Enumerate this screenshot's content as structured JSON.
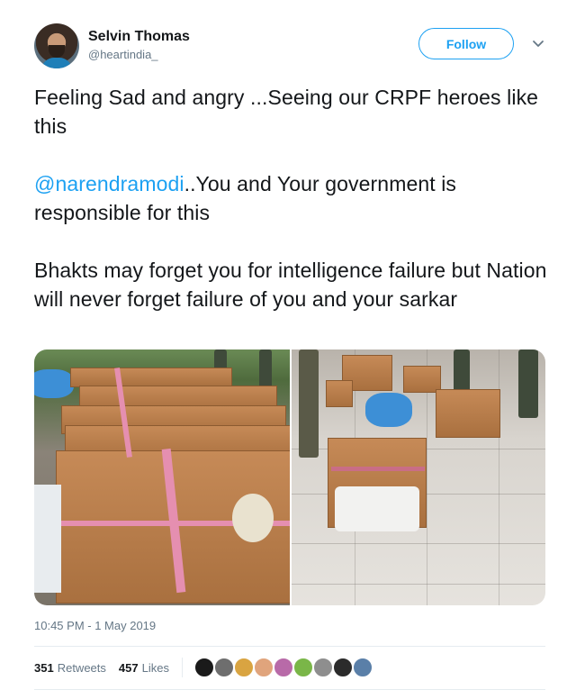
{
  "author": {
    "name": "Selvin Thomas",
    "handle": "@heartindia_",
    "avatar_icon": "user-avatar-photo"
  },
  "follow": {
    "label": "Follow",
    "color": "#1da1f2"
  },
  "menu": {
    "icon": "chevron-down-icon"
  },
  "tweet": {
    "line1": "Feeling Sad and angry ...Seeing our CRPF heroes like this",
    "mention": "@narendramodi",
    "line2_rest": "..You and Your government is responsible for this",
    "line3": "Bhakts may forget you for intelligence failure but Nation will never forget failure of you and your sarkar"
  },
  "media": {
    "photos": [
      {
        "name": "left-photo",
        "icon": "cardboard-coffins-outdoors"
      },
      {
        "name": "right-photo",
        "icon": "cardboard-coffins-on-tiled-floor"
      }
    ]
  },
  "meta": {
    "timestamp": "10:45 PM - 1 May 2019"
  },
  "stats": {
    "retweets_count": "351",
    "retweets_label": "Retweets",
    "likes_count": "457",
    "likes_label": "Likes"
  },
  "likers": [
    "#1a1a1a",
    "#6e6e6e",
    "#d9a441",
    "#e0a47c",
    "#b86aa8",
    "#7ab648",
    "#8e8e8e",
    "#2b2b2b",
    "#5a7fa8"
  ]
}
